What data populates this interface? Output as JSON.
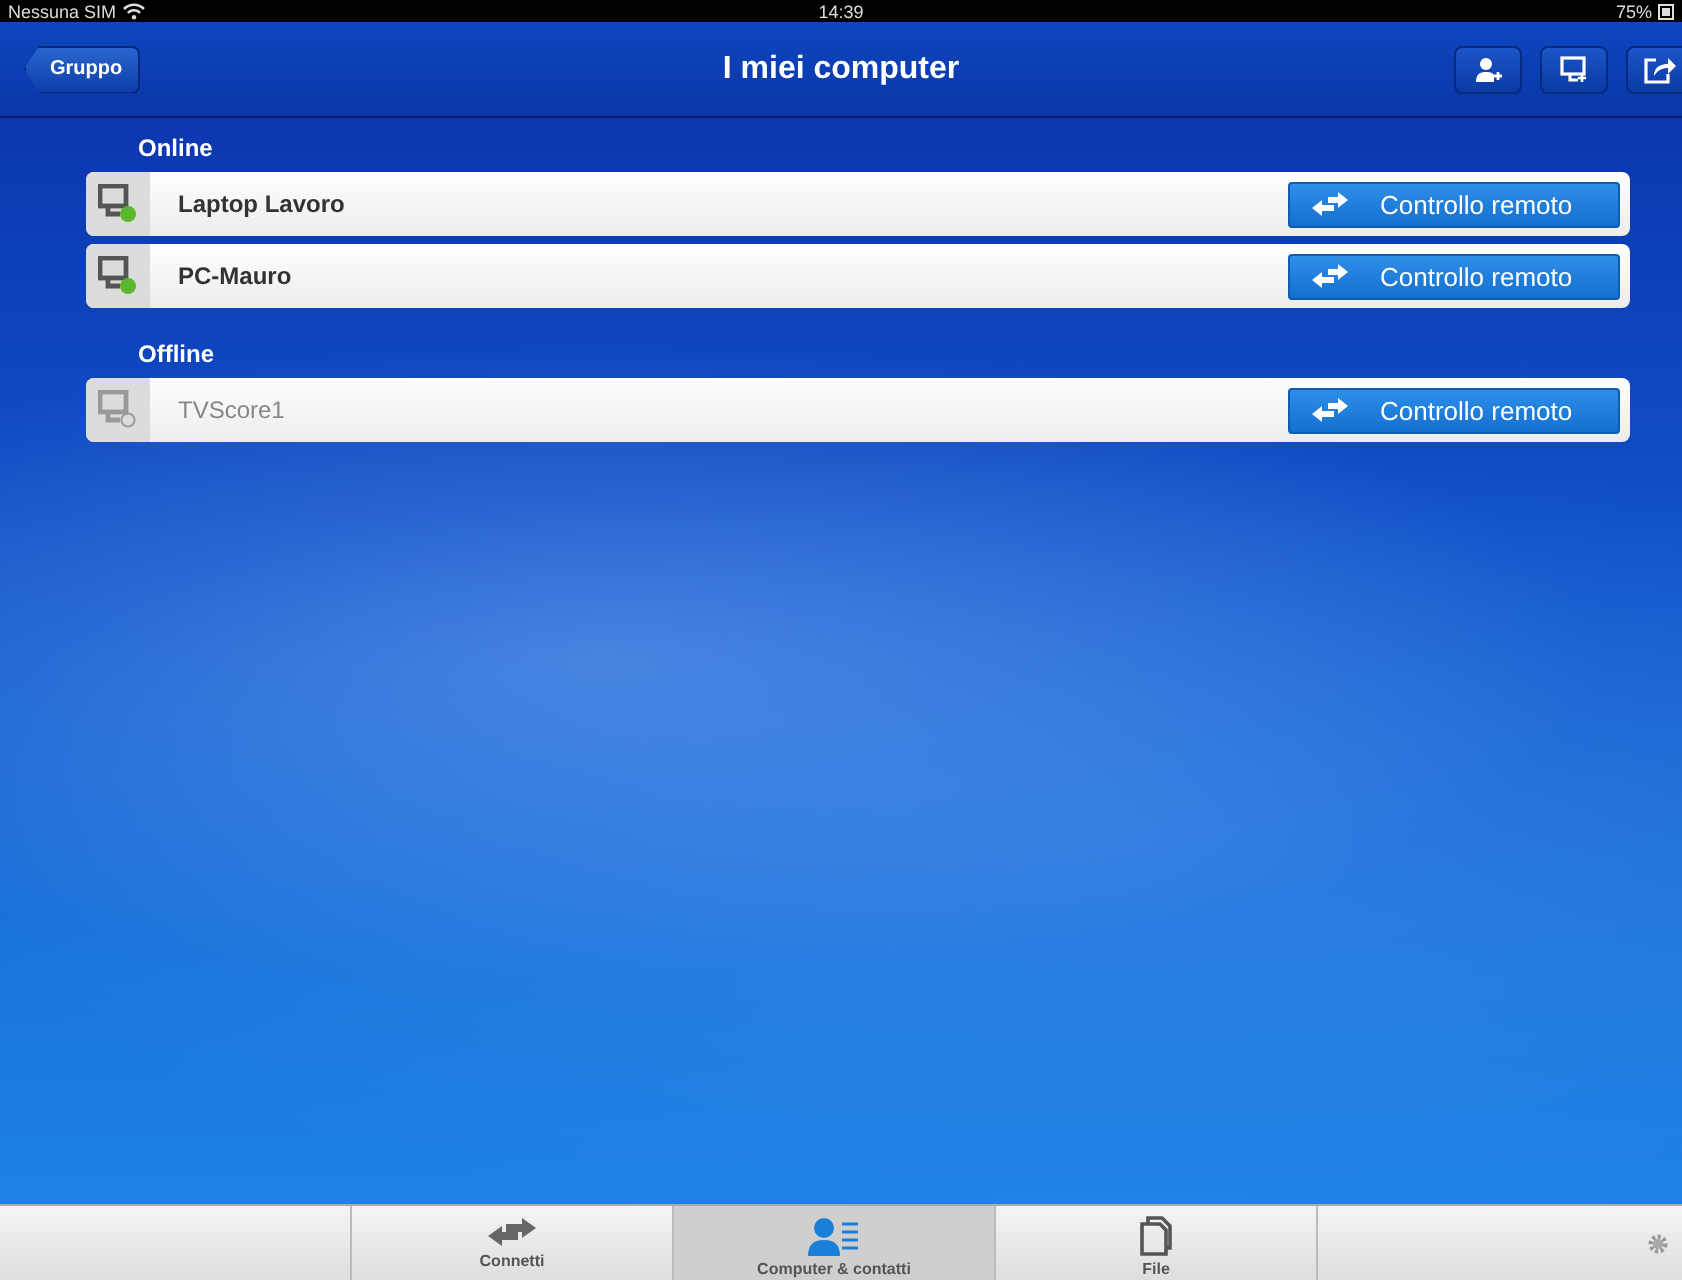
{
  "status_bar": {
    "carrier": "Nessuna SIM",
    "time": "14:39",
    "battery": "75%"
  },
  "nav_bar": {
    "back": "Gruppo",
    "title": "I miei computer"
  },
  "sections": [
    {
      "title": "Online",
      "devices": [
        {
          "name": "Laptop Lavoro",
          "online": true,
          "action": "Controllo remoto"
        },
        {
          "name": "PC-Mauro",
          "online": true,
          "action": "Controllo remoto"
        }
      ]
    },
    {
      "title": "Offline",
      "devices": [
        {
          "name": "TVScore1",
          "online": false,
          "action": "Controllo remoto"
        }
      ]
    }
  ],
  "tab_bar": [
    {
      "label": "Connetti",
      "kind": "connect",
      "selected": false
    },
    {
      "label": "Computer & contatti",
      "kind": "contacts",
      "selected": true
    },
    {
      "label": "File",
      "kind": "files",
      "selected": false
    }
  ]
}
